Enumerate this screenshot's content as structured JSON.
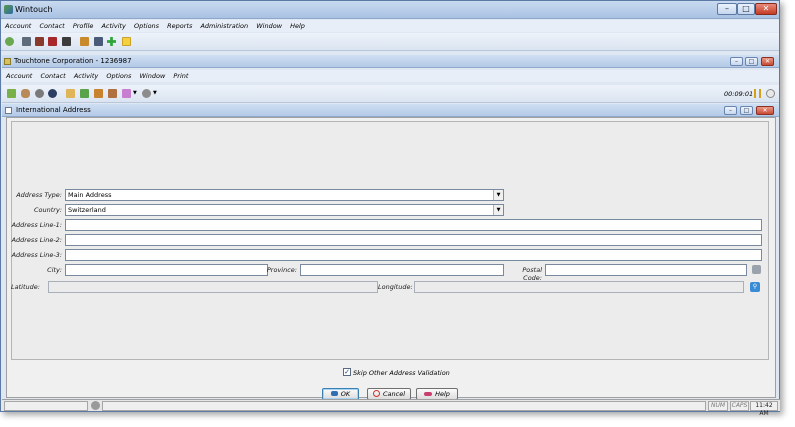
{
  "app": {
    "title": "Wintouch",
    "menu": [
      "Account",
      "Contact",
      "Profile",
      "Activity",
      "Options",
      "Reports",
      "Administration",
      "Window",
      "Help"
    ]
  },
  "contact_window": {
    "title": "Touchtone Corporation - 1236987",
    "menu": [
      "Account",
      "Contact",
      "Activity",
      "Options",
      "Window",
      "Print"
    ],
    "timer": "00:09:01"
  },
  "dialog": {
    "title": "International Address",
    "address_type": {
      "label": "Address Type:",
      "value": "Main Address"
    },
    "country": {
      "label": "Country:",
      "value": "Switzerland"
    },
    "line1": {
      "label": "Address Line-1:",
      "value": ""
    },
    "line2": {
      "label": "Address Line-2:",
      "value": ""
    },
    "line3": {
      "label": "Address Line-3:",
      "value": ""
    },
    "city": {
      "label": "City:",
      "value": ""
    },
    "province": {
      "label": "Province:",
      "value": ""
    },
    "postal": {
      "label": "Postal Code:",
      "value": ""
    },
    "latitude": {
      "label": "Latitude:",
      "value": ""
    },
    "longitude": {
      "label": "Longitude:",
      "value": ""
    },
    "skip_validation": {
      "label": "Skip Other Address Validation",
      "checked": true
    },
    "buttons": {
      "ok": "OK",
      "cancel": "Cancel",
      "help": "Help"
    }
  },
  "statusbar": {
    "num": "NUM",
    "caps": "CAPS",
    "time": "11:42 AM"
  },
  "colors": {
    "titlebar": "#b9cfea",
    "close": "#c84a33",
    "accent": "#3c7fb1"
  }
}
